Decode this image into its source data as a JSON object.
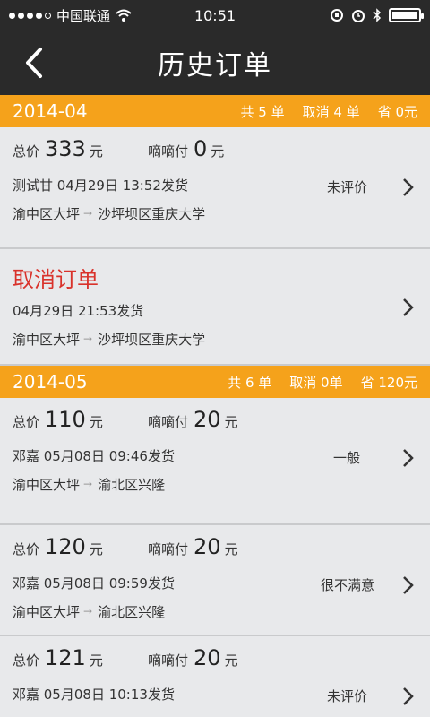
{
  "status_bar": {
    "carrier": "中国联通",
    "time": "10:51"
  },
  "nav": {
    "title": "历史订单",
    "icons": {
      "back": "back-chevron-icon"
    }
  },
  "colors": {
    "accent": "#f5a21b",
    "cancel": "#d9322b",
    "bar": "#2a2a2a"
  },
  "months": [
    {
      "month": "2014-04",
      "total": "共 5 单",
      "cancelled": "取消 4 单",
      "saved": "省 0元",
      "orders": [
        {
          "total_label": "总价",
          "total_value": "333",
          "currency": "元",
          "paid_label": "嘀嘀付",
          "paid_value": "0",
          "paid_currency": "元",
          "sender": "测试甘 04月29日 13:52发货",
          "rating": "未评价",
          "from": "渝中区大坪",
          "to": "沙坪坝区重庆大学"
        },
        {
          "cancel_title": "取消订单",
          "sender": "04月29日 21:53发货",
          "from": "渝中区大坪",
          "to": "沙坪坝区重庆大学"
        }
      ]
    },
    {
      "month": "2014-05",
      "total": "共 6 单",
      "cancelled": "取消 0单",
      "saved": "省 120元",
      "orders": [
        {
          "total_label": "总价",
          "total_value": "110",
          "currency": "元",
          "paid_label": "嘀嘀付",
          "paid_value": "20",
          "paid_currency": "元",
          "sender": "邓嘉 05月08日 09:46发货",
          "rating": "一般",
          "from": "渝中区大坪",
          "to": "渝北区兴隆"
        },
        {
          "total_label": "总价",
          "total_value": "120",
          "currency": "元",
          "paid_label": "嘀嘀付",
          "paid_value": "20",
          "paid_currency": "元",
          "sender": "邓嘉 05月08日 09:59发货",
          "rating": "很不满意",
          "from": "渝中区大坪",
          "to": "渝北区兴隆"
        },
        {
          "total_label": "总价",
          "total_value": "121",
          "currency": "元",
          "paid_label": "嘀嘀付",
          "paid_value": "20",
          "paid_currency": "元",
          "sender": "邓嘉 05月08日 10:13发货",
          "rating": "未评价"
        }
      ]
    }
  ]
}
